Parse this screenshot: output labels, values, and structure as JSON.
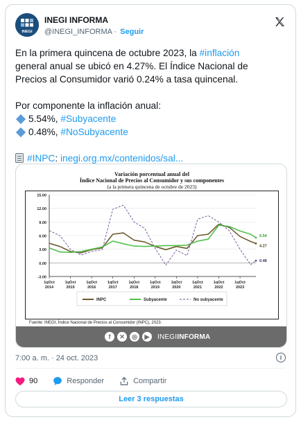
{
  "account": {
    "name": "INEGI INFORMA",
    "handle": "@INEGI_INFORMA",
    "separator": "·",
    "follow_label": "Seguir",
    "avatar_text": "INEGI"
  },
  "tweet": {
    "line1_pre": "En la primera quincena de octubre 2023, la ",
    "line1_tag": "#inflación",
    "line2": "general anual se ubicó en 4.27%. El Índice Nacional de",
    "line3": "Precios al Consumidor varió 0.24% a tasa quincenal.",
    "line4": "Por componente la inflación anual:",
    "item1_value": "5.54%, ",
    "item1_tag": "#Subyacente",
    "item2_value": "0.48%, ",
    "item2_tag": "#NoSubyacente",
    "link_tag": "#INPC",
    "link_sep": ": ",
    "link_url": "inegi.org.mx/contenidos/sal..."
  },
  "media": {
    "title_line1": "Variación porcentual anual del",
    "title_line2": "Índice Nacional de Precios al Consumidor y sus componentes",
    "title_line3": "(a la primera quincena de octubre de 2023)",
    "source": "Fuente: INEGI, Índice Nacional de Precios al Consumidor (INPC), 2023.",
    "brand_light": "INEGI",
    "brand_bold": "INFORMA",
    "social_icons": [
      "facebook-icon",
      "x-icon",
      "instagram-icon",
      "youtube-icon"
    ]
  },
  "chart_data": {
    "type": "line",
    "title": "Variación porcentual anual del Índice Nacional de Precios al Consumidor y sus componentes",
    "subtitle": "(a la primera quincena de octubre de 2023)",
    "xlabel": "",
    "ylabel": "",
    "ylim": [
      -3,
      15
    ],
    "yticks": [
      "15.00",
      "12.00",
      "9.00",
      "6.00",
      "3.00",
      "0.00",
      "-3.00"
    ],
    "xticks": [
      {
        "l1": "1qOct",
        "l2": "2014"
      },
      {
        "l1": "1qOct",
        "l2": "2015"
      },
      {
        "l1": "1qOct",
        "l2": "2016"
      },
      {
        "l1": "1qOct",
        "l2": "2017"
      },
      {
        "l1": "1qOct",
        "l2": "2018"
      },
      {
        "l1": "1qOct",
        "l2": "2019"
      },
      {
        "l1": "1qOct",
        "l2": "2020"
      },
      {
        "l1": "1qOct",
        "l2": "2021"
      },
      {
        "l1": "1qOct",
        "l2": "2022"
      },
      {
        "l1": "1qOct",
        "l2": "2023"
      }
    ],
    "x": [
      2014.0,
      2014.5,
      2015.0,
      2015.5,
      2016.0,
      2016.5,
      2017.0,
      2017.5,
      2018.0,
      2018.5,
      2019.0,
      2019.5,
      2020.0,
      2020.5,
      2021.0,
      2021.5,
      2022.0,
      2022.5,
      2023.0,
      2023.5,
      2023.75
    ],
    "series": [
      {
        "name": "INPC",
        "color": "#6b5a2e",
        "dash": "",
        "values": [
          4.3,
          3.6,
          2.5,
          2.2,
          2.9,
          3.3,
          6.3,
          6.6,
          5.0,
          4.6,
          3.6,
          2.9,
          3.6,
          3.2,
          6.0,
          6.3,
          8.5,
          7.8,
          5.8,
          4.7,
          4.27
        ]
      },
      {
        "name": "Subyacente",
        "color": "#52c04a",
        "dash": "",
        "values": [
          3.3,
          2.4,
          2.3,
          2.5,
          3.0,
          3.5,
          4.8,
          4.2,
          3.7,
          3.6,
          3.7,
          3.8,
          3.8,
          3.9,
          4.8,
          5.2,
          8.3,
          8.0,
          7.0,
          6.3,
          5.54
        ]
      },
      {
        "name": "No subyacente",
        "color": "#6a4c93",
        "dash": "3,2",
        "values": [
          7.1,
          6.0,
          3.0,
          1.7,
          2.5,
          2.9,
          11.8,
          12.7,
          9.0,
          7.6,
          3.2,
          -0.5,
          2.8,
          1.6,
          9.6,
          10.4,
          9.0,
          7.0,
          3.0,
          -0.4,
          0.48
        ]
      }
    ],
    "end_labels": [
      "5.54",
      "4.27",
      "0.48"
    ],
    "legend_position": "bottom"
  },
  "footer": {
    "timestamp": "7:00 a. m. · 24 oct. 2023",
    "likes": "90",
    "reply_label": "Responder",
    "share_label": "Compartir",
    "read_replies": "Leer 3 respuestas"
  }
}
